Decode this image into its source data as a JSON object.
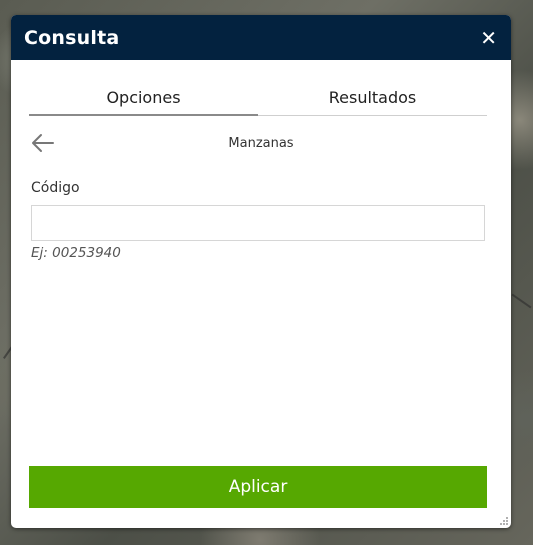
{
  "widget": {
    "title": "Consulta",
    "close_icon": "close-icon",
    "colors": {
      "titlebar": "#03223f",
      "apply_button": "#56a801"
    }
  },
  "tabs": [
    {
      "label": "Opciones",
      "active": true
    },
    {
      "label": "Resultados",
      "active": false
    }
  ],
  "options": {
    "back_icon": "arrow-left-icon",
    "section_title": "Manzanas",
    "field_label": "Código",
    "field_value": "",
    "field_placeholder": "",
    "hint": "Ej: 00253940",
    "apply_label": "Aplicar"
  }
}
